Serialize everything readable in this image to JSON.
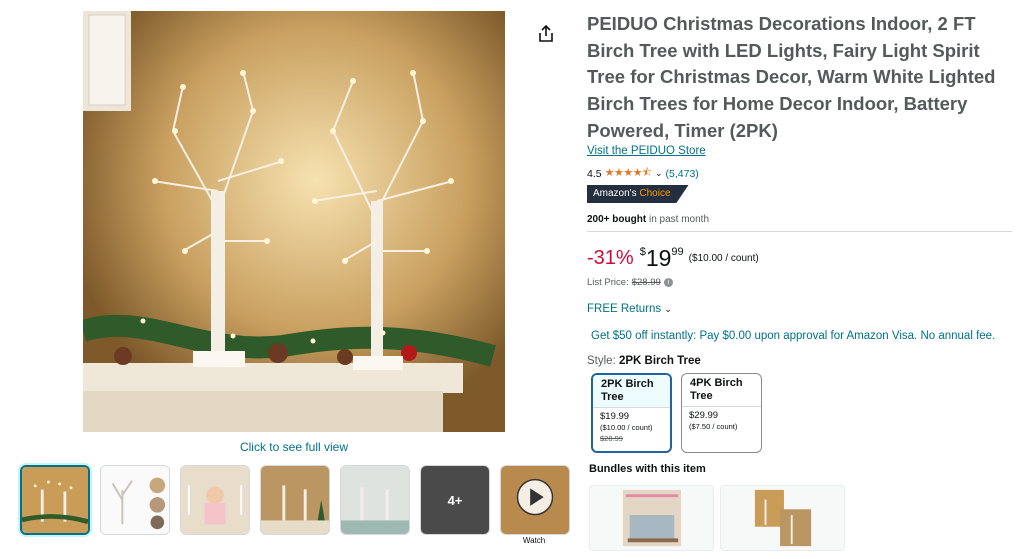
{
  "product": {
    "title": "PEIDUO Christmas Decorations Indoor, 2 FT Birch Tree with LED Lights, Fairy Light Spirit Tree for Christmas Decor, Warm White Lighted Birch Trees for Home Decor Indoor, Battery Powered, Timer (2PK)",
    "store_link": "Visit the PEIDUO Store",
    "rating": "4.5",
    "stars": "★★★★⯪",
    "rating_count": "(5,473)",
    "badge_prefix": "Amazon's",
    "badge_choice": "Choice",
    "bought_bold": "200+ bought",
    "bought_rest": "in past month"
  },
  "price": {
    "discount": "-31%",
    "currency": "$",
    "whole": "19",
    "fraction": "99",
    "unit": "($10.00 / count)",
    "list_label": "List Price:",
    "list_value": "$28.99"
  },
  "returns": "FREE Returns",
  "promo": "Get $50 off instantly: Pay $0.00 upon approval for Amazon Visa. No annual fee.",
  "style": {
    "label": "Style:",
    "selected": "2PK Birch Tree",
    "options": [
      {
        "name": "2PK Birch Tree",
        "price": "$19.99",
        "unit": "($10.00 / count)",
        "list": "$28.99"
      },
      {
        "name": "4PK Birch Tree",
        "price": "$29.99",
        "unit": "($7.50 / count)",
        "list": ""
      }
    ]
  },
  "bundles_title": "Bundles with this item",
  "gallery": {
    "full_view": "Click to see full view",
    "more_count": "4+",
    "video_caption": "Watch"
  },
  "colors": {
    "link": "#007185",
    "discount": "#cc0c39",
    "star": "#de7921",
    "badge_bg": "#232f3e",
    "badge_choice": "#ff9900"
  },
  "icons": [
    "share-icon",
    "chevron-down-icon",
    "info-icon",
    "play-icon"
  ]
}
